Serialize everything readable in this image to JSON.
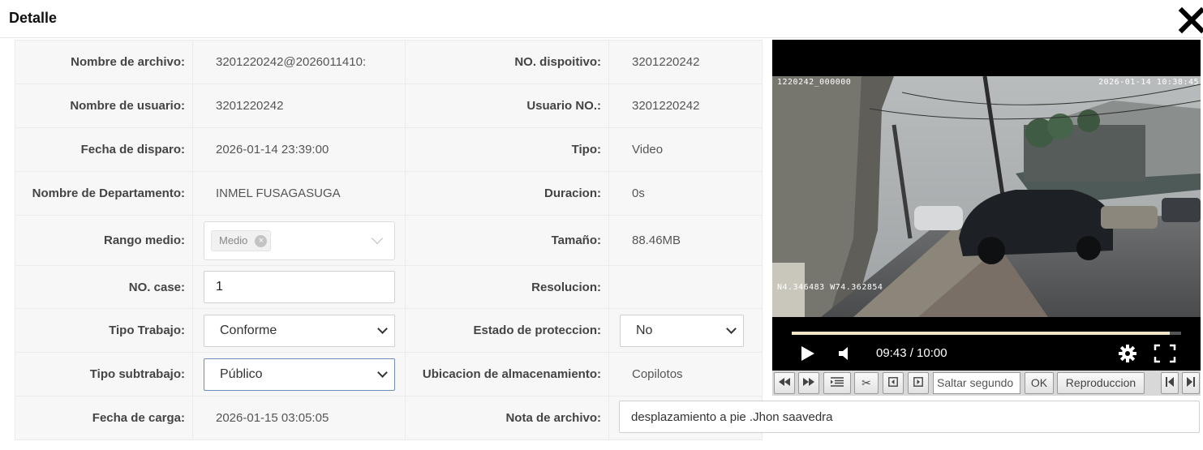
{
  "header": {
    "title": "Detalle"
  },
  "details": {
    "file_name_label": "Nombre de archivo:",
    "file_name_value": "3201220242@2026011410:",
    "device_no_label": "NO. dispoitivo:",
    "device_no_value": "3201220242",
    "user_name_label": "Nombre de usuario:",
    "user_name_value": "3201220242",
    "user_no_label": "Usuario NO.:",
    "user_no_value": "3201220242",
    "trigger_date_label": "Fecha de disparo:",
    "trigger_date_value": "2026-01-14 23:39:00",
    "type_label": "Tipo:",
    "type_value": "Video",
    "department_label": "Nombre de Departamento:",
    "department_value": "INMEL FUSAGASUGA",
    "duration_label": "Duracion:",
    "duration_value": "0s",
    "media_range_label": "Rango medio:",
    "media_range_tag": "Medio",
    "size_label": "Tamaño:",
    "size_value": "88.46MB",
    "case_no_label": "NO. case:",
    "case_no_value": "1",
    "resolution_label": "Resolucion:",
    "resolution_value": "",
    "work_type_label": "Tipo Trabajo:",
    "work_type_value": "Conforme",
    "protection_label": "Estado de proteccion:",
    "protection_value": "No",
    "work_subtype_label": "Tipo subtrabajo:",
    "work_subtype_value": "Público",
    "storage_label": "Ubicacion de almacenamiento:",
    "storage_value": "Copilotos",
    "upload_date_label": "Fecha de carga:",
    "upload_date_value": "2026-01-15 03:05:05",
    "file_note_label": "Nota de archivo:",
    "file_note_value": "desplazamiento a pie .Jhon saavedra"
  },
  "player": {
    "osd_top_left": "1220242_000000",
    "osd_top_right": "2026-01-14 10:38:45",
    "osd_bottom_left": "N4.346483 W74.362854",
    "time_display": "09:43 / 10:00",
    "progress_fraction": 0.97
  },
  "toolbar": {
    "seek_placeholder": "Saltar segundo",
    "ok_label": "OK",
    "playback_label": "Reproduccion"
  },
  "icons": {
    "close": "close-icon",
    "play": "play-icon",
    "volume": "volume-icon",
    "settings": "gear-icon",
    "fullscreen": "fullscreen-icon"
  }
}
